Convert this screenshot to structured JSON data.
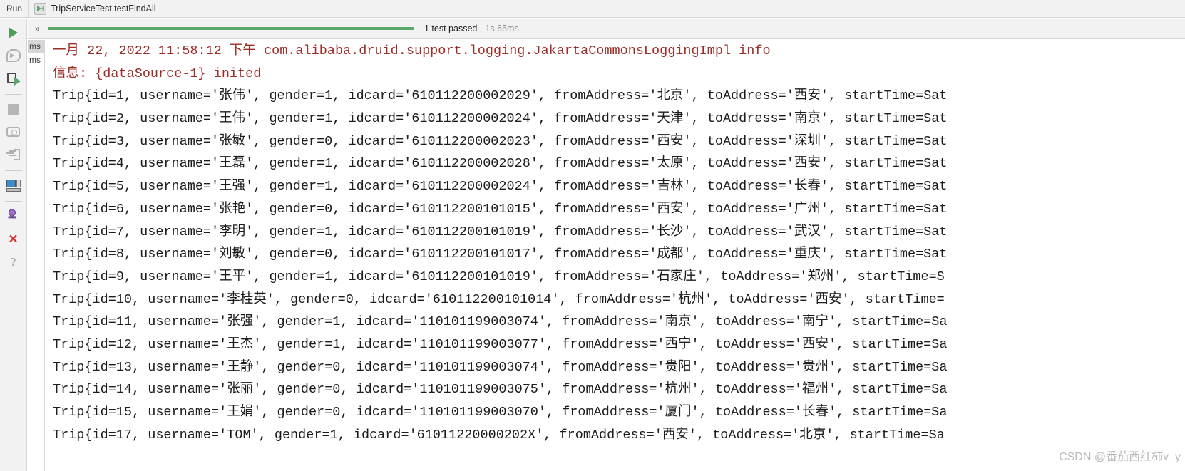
{
  "header": {
    "run_label": "Run",
    "tab_title": "TripServiceTest.testFindAll",
    "tab_icon": "run-test-icon"
  },
  "toolbar": {
    "items": [
      {
        "name": "rerun-button",
        "icon": "play-triangle-icon",
        "label": ""
      },
      {
        "name": "toggle-auto-test-button",
        "icon": "auto-test-icon",
        "label": ""
      },
      {
        "name": "rerun-failed-button",
        "icon": "rerun-failed-icon",
        "label": ""
      },
      {
        "name": "stop-button",
        "icon": "stop-square-icon",
        "label": ""
      },
      {
        "name": "dump-threads-button",
        "icon": "camera-icon",
        "label": ""
      },
      {
        "name": "export-test-results-button",
        "icon": "export-arrow-icon",
        "label": ""
      },
      {
        "name": "open-console-button",
        "icon": "console-window-icon",
        "label": ""
      },
      {
        "name": "pin-tab-button",
        "icon": "pin-icon",
        "label": ""
      },
      {
        "name": "close-button",
        "icon": "close-x-icon",
        "label": "×"
      },
      {
        "name": "help-button",
        "icon": "question-mark-icon",
        "label": "?"
      }
    ]
  },
  "progress": {
    "expand_chevrons": "»",
    "status_text": "1 test passed",
    "duration": "- 1s 65ms",
    "bar_color": "#59a869",
    "bar_percent": 100
  },
  "tree": {
    "rows": [
      {
        "label": "ms",
        "selected": true
      },
      {
        "label": "ms",
        "selected": false
      }
    ]
  },
  "console": {
    "lines": [
      {
        "text": "一月 22, 2022 11:58:12 下午 com.alibaba.druid.support.logging.JakartaCommonsLoggingImpl info",
        "level": "error"
      },
      {
        "text": "信息: {dataSource-1} inited",
        "level": "error"
      },
      {
        "text": "Trip{id=1, username='张伟', gender=1, idcard='610112200002029', fromAddress='北京', toAddress='西安', startTime=Sat",
        "level": "info"
      },
      {
        "text": "Trip{id=2, username='王伟', gender=1, idcard='610112200002024', fromAddress='天津', toAddress='南京', startTime=Sat",
        "level": "info"
      },
      {
        "text": "Trip{id=3, username='张敏', gender=0, idcard='610112200002023', fromAddress='西安', toAddress='深圳', startTime=Sat",
        "level": "info"
      },
      {
        "text": "Trip{id=4, username='王磊', gender=1, idcard='610112200002028', fromAddress='太原', toAddress='西安', startTime=Sat",
        "level": "info"
      },
      {
        "text": "Trip{id=5, username='王强', gender=1, idcard='610112200002024', fromAddress='吉林', toAddress='长春', startTime=Sat",
        "level": "info"
      },
      {
        "text": "Trip{id=6, username='张艳', gender=0, idcard='610112200101015', fromAddress='西安', toAddress='广州', startTime=Sat",
        "level": "info"
      },
      {
        "text": "Trip{id=7, username='李明', gender=1, idcard='610112200101019', fromAddress='长沙', toAddress='武汉', startTime=Sat",
        "level": "info"
      },
      {
        "text": "Trip{id=8, username='刘敏', gender=0, idcard='610112200101017', fromAddress='成都', toAddress='重庆', startTime=Sat",
        "level": "info"
      },
      {
        "text": "Trip{id=9, username='王平', gender=1, idcard='610112200101019', fromAddress='石家庄', toAddress='郑州', startTime=S",
        "level": "info"
      },
      {
        "text": "Trip{id=10, username='李桂英', gender=0, idcard='610112200101014', fromAddress='杭州', toAddress='西安', startTime=",
        "level": "info"
      },
      {
        "text": "Trip{id=11, username='张强', gender=1, idcard='110101199003074', fromAddress='南京', toAddress='南宁', startTime=Sa",
        "level": "info"
      },
      {
        "text": "Trip{id=12, username='王杰', gender=1, idcard='110101199003077', fromAddress='西宁', toAddress='西安', startTime=Sa",
        "level": "info"
      },
      {
        "text": "Trip{id=13, username='王静', gender=0, idcard='110101199003074', fromAddress='贵阳', toAddress='贵州', startTime=Sa",
        "level": "info"
      },
      {
        "text": "Trip{id=14, username='张丽', gender=0, idcard='110101199003075', fromAddress='杭州', toAddress='福州', startTime=Sa",
        "level": "info"
      },
      {
        "text": "Trip{id=15, username='王娟', gender=0, idcard='110101199003070', fromAddress='厦门', toAddress='长春', startTime=Sa",
        "level": "info"
      },
      {
        "text": "Trip{id=17, username='TOM', gender=1, idcard='61011220000202X', fromAddress='西安', toAddress='北京', startTime=Sa",
        "level": "info"
      }
    ]
  },
  "watermark": {
    "text": "CSDN @番茄西红柿v_y"
  },
  "colors": {
    "accent_green": "#59a869",
    "error_red": "#9d2d28",
    "text": "#1c1c1c",
    "chrome": "#f2f2f2"
  }
}
